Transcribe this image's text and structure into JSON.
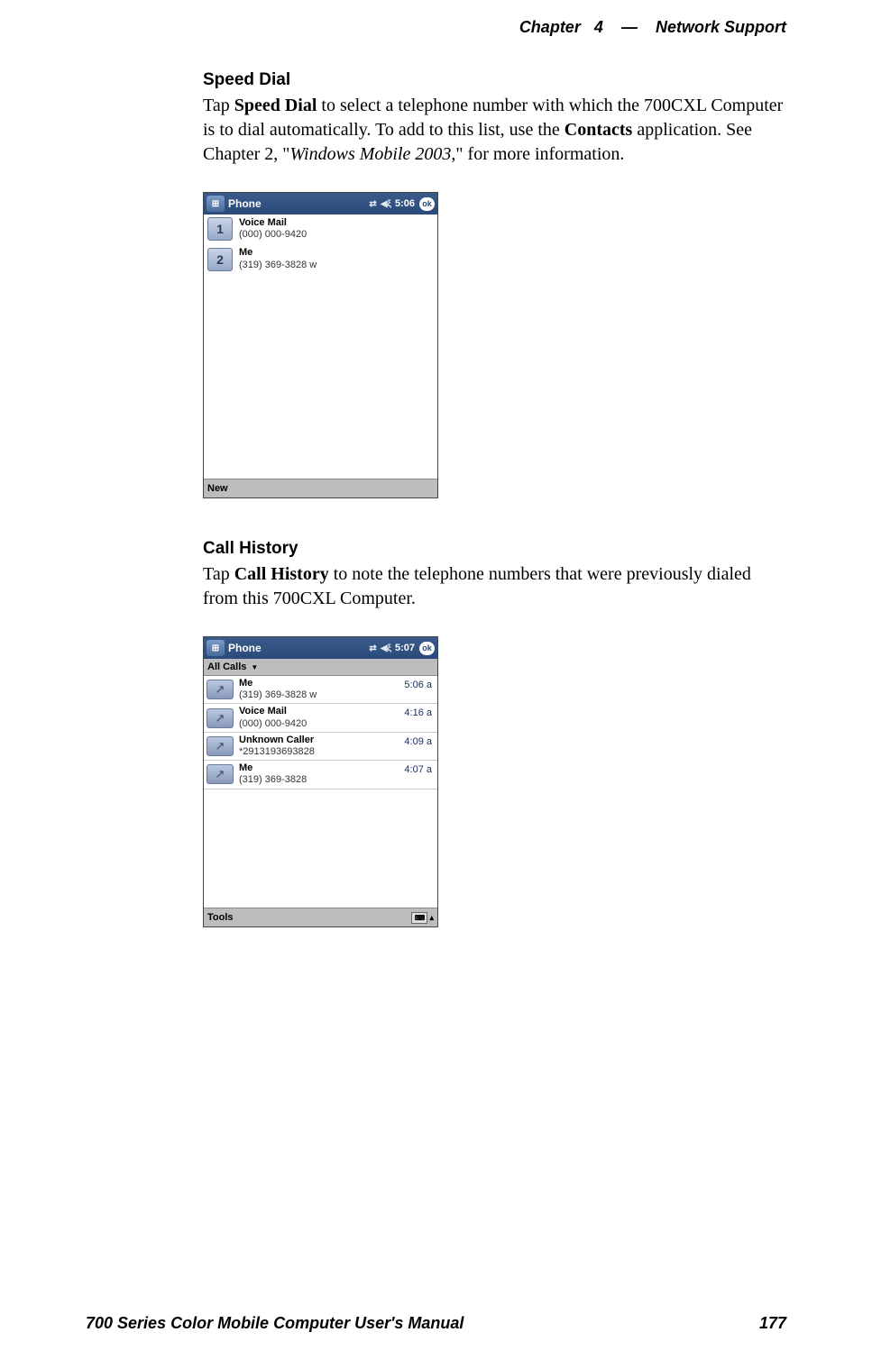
{
  "header": {
    "chapter": "Chapter",
    "chapter_num": "4",
    "dash": "—",
    "title": "Network Support"
  },
  "section1": {
    "heading": "Speed Dial",
    "text_pre": "Tap ",
    "text_bold1": "Speed Dial",
    "text_mid1": " to select a telephone number with which the 700CXL Computer is to dial automatically. To add to this list, use the ",
    "text_bold2": "Contacts",
    "text_mid2": " application. See Chapter 2, \"",
    "text_italic": "Windows Mobile 2003,",
    "text_end": "\" for more information."
  },
  "screenshot1": {
    "app": "Phone",
    "time": "5:06",
    "ok": "ok",
    "items": [
      {
        "num": "1",
        "name": "Voice Mail",
        "number": "(000) 000-9420"
      },
      {
        "num": "2",
        "name": "Me",
        "number": "(319) 369-3828 w"
      }
    ],
    "bottombar": "New"
  },
  "section2": {
    "heading": "Call History",
    "text_pre": "Tap ",
    "text_bold1": "Call History",
    "text_end": " to note the telephone numbers that were previously dialed from this 700CXL Computer."
  },
  "screenshot2": {
    "app": "Phone",
    "time": "5:07",
    "ok": "ok",
    "filter": "All Calls",
    "items": [
      {
        "name": "Me",
        "number": "(319) 369-3828 w",
        "time": "5:06 a"
      },
      {
        "name": "Voice Mail",
        "number": "(000) 000-9420",
        "time": "4:16 a"
      },
      {
        "name": "Unknown Caller",
        "number": "*2913193693828",
        "time": "4:09 a"
      },
      {
        "name": "Me",
        "number": "(319) 369-3828",
        "time": "4:07 a"
      }
    ],
    "bottombar": "Tools"
  },
  "footer": {
    "manual": "700 Series Color Mobile Computer User's Manual",
    "page": "177"
  }
}
